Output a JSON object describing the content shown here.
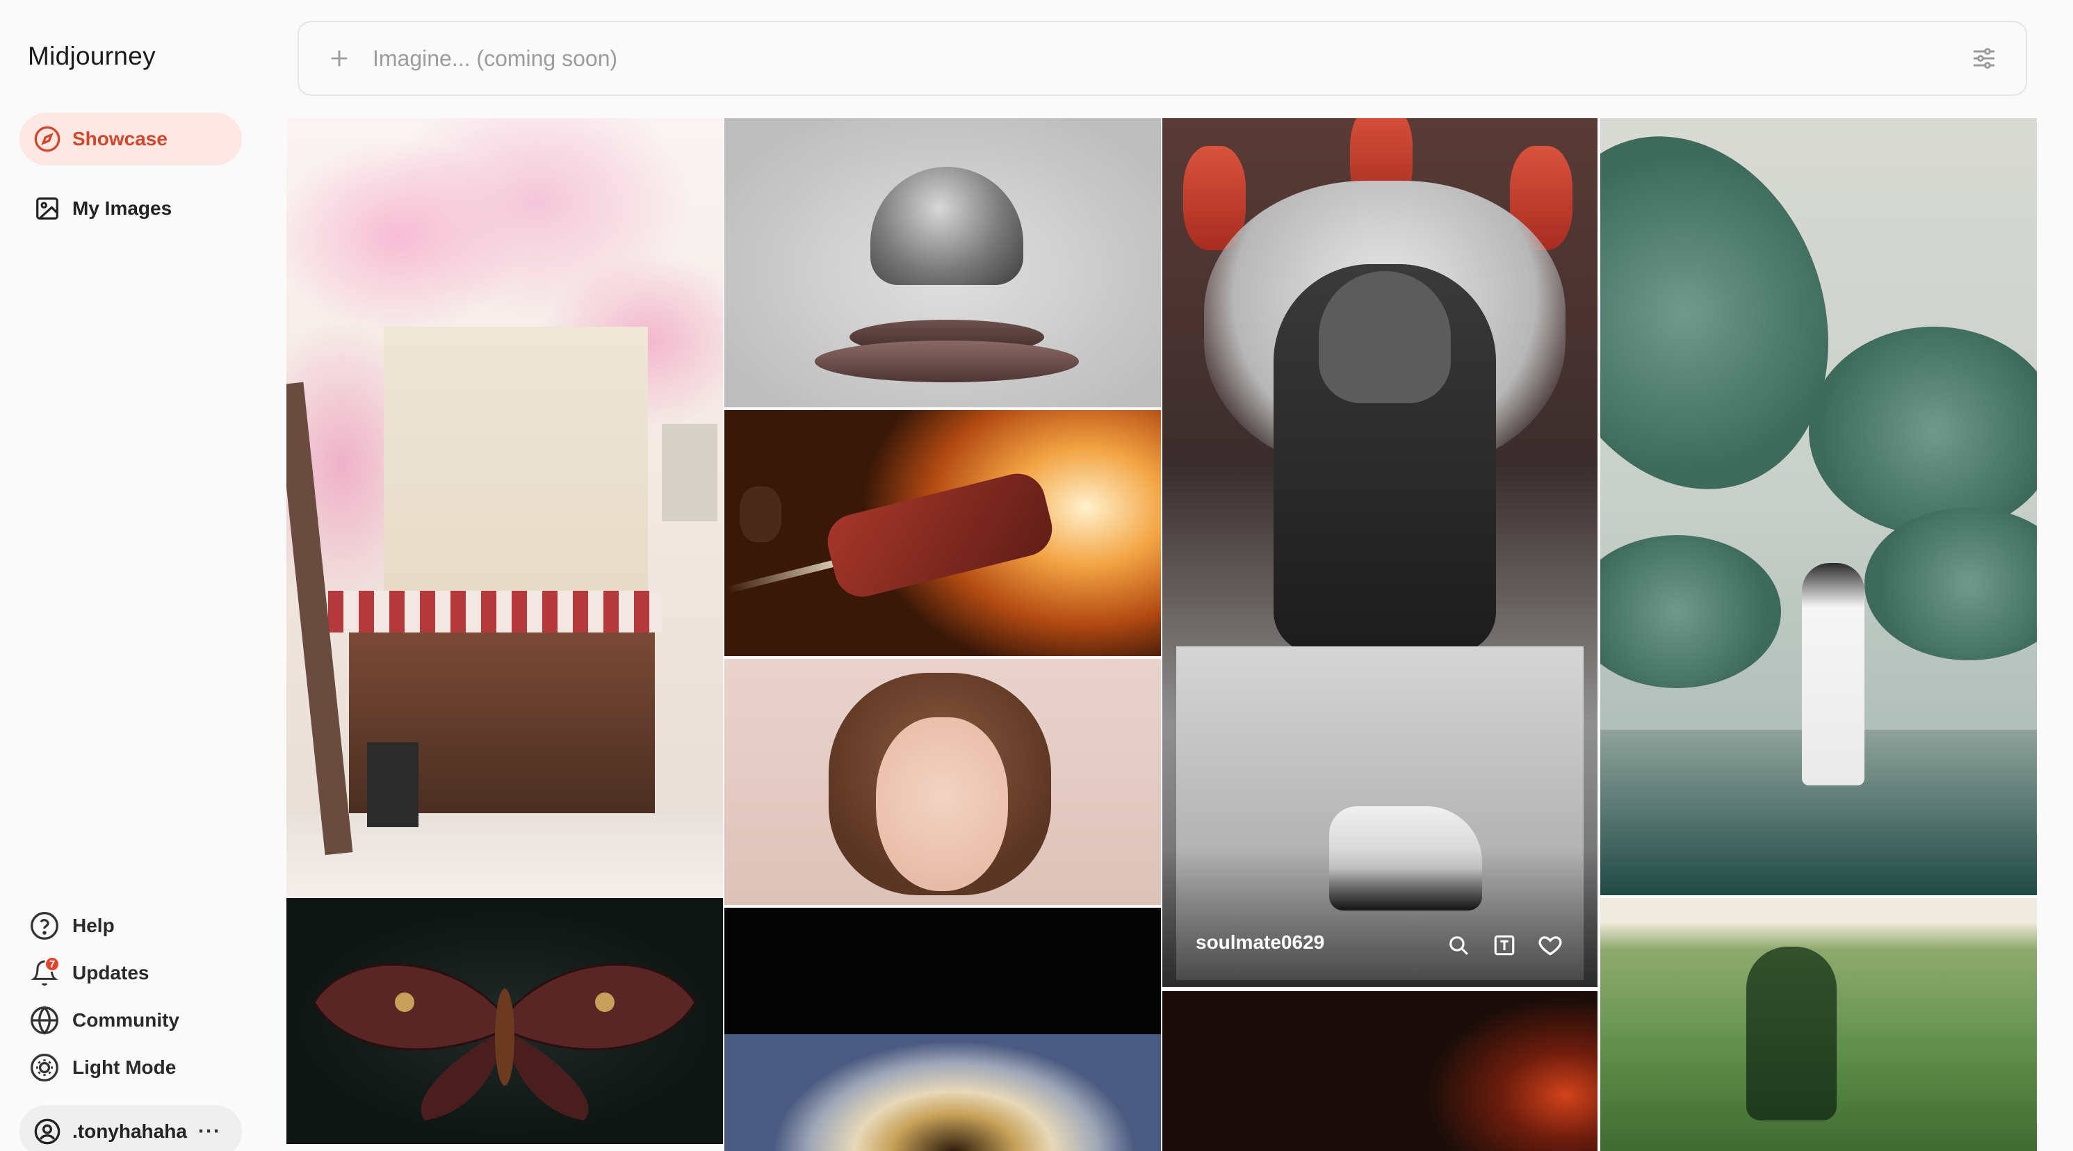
{
  "app": {
    "logo": "Midjourney"
  },
  "sidebar": {
    "nav": [
      {
        "label": "Showcase",
        "icon": "compass-icon",
        "active": true
      },
      {
        "label": "My Images",
        "icon": "image-icon",
        "active": false
      }
    ],
    "bottom_links": [
      {
        "label": "Help",
        "icon": "question-circle-icon"
      },
      {
        "label": "Updates",
        "icon": "bell-icon",
        "badge": "7"
      },
      {
        "label": "Community",
        "icon": "globe-icon"
      },
      {
        "label": "Light Mode",
        "icon": "sun-icon"
      }
    ],
    "user": {
      "name": ".tonyhahaha",
      "icon": "user-circle-icon",
      "more": "···"
    }
  },
  "search": {
    "placeholder": "Imagine... (coming soon)",
    "value": ""
  },
  "gallery": {
    "hovered_tile": {
      "author": "soulmate0629",
      "actions": [
        "search-icon",
        "text-prompt-icon",
        "heart-icon"
      ]
    }
  },
  "colors": {
    "accent": "#d4452b",
    "accent_bg": "#fde8e3",
    "badge": "#e0452b"
  }
}
